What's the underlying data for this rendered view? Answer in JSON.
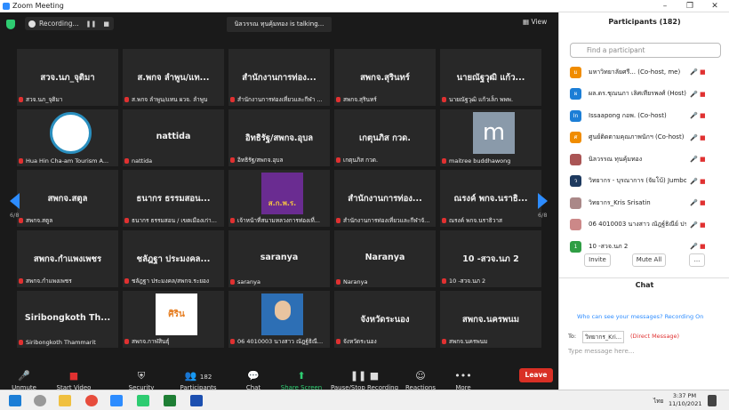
{
  "window": {
    "title": "Zoom Meeting",
    "minimize": "–",
    "maximize": "❐",
    "close": "✕"
  },
  "topbar": {
    "recording": "Recording...",
    "pause": "❚❚",
    "stop": "■",
    "talking": "นิลวรรณ ทุนคุ้มทอง is talking...",
    "view": "View"
  },
  "tiles": [
    {
      "name": "สวจ.นภ_จุติมา",
      "label": "สวจ.นภ_จุติมา"
    },
    {
      "name": "ส.พกจ ลำพูน/แท...",
      "label": "ส.พกจ ลำพูน/แทน ผวจ. ลำพูน"
    },
    {
      "name": "สำนักงานการท่อง...",
      "label": "สำนักงานการท่องเที่ยวและกีฬา ..."
    },
    {
      "name": "สพกจ.สุรินทร์",
      "label": "สพกจ.สุรินทร์"
    },
    {
      "name": "นายณัฐวุฒิ แก้ว...",
      "label": "นายณัฐวุฒิ แก้วเล็ก พพพ."
    },
    {
      "name": "",
      "label": "Hua Hin Cha-am Tourism A..."
    },
    {
      "name": "nattida",
      "label": "nattida"
    },
    {
      "name": "อิทธิรัฐ/สพกจ.อุบล",
      "label": "อิทธิรัฐ/สพกจ.อุบล"
    },
    {
      "name": "เกตุนภิส กวด.",
      "label": "เกตุนภิส กวด."
    },
    {
      "name": "m",
      "label": "maitree buddhawong"
    },
    {
      "name": "สพกจ.สตูล",
      "label": "สพกจ.สตูล"
    },
    {
      "name": "ธนากร ธรรมสอน...",
      "label": "ธนากร ธรรมสอน / เขตเมืองเก่า..."
    },
    {
      "name": "ส.ก.พ.ร.",
      "label": "เจ้าหน้าที่สนามหลวงการท่องเที่..."
    },
    {
      "name": "สำนักงานการท่อง...",
      "label": "สำนักงานการท่องเที่ยวและกีฬาจั..."
    },
    {
      "name": "ณรงค์ พกจ.นราธิ...",
      "label": "ณรงค์ พกจ.นราธิวาส"
    },
    {
      "name": "สพกจ.กำแพงเพชร",
      "label": "สพกจ.กำแพงเพชร"
    },
    {
      "name": "ชลัฎฐา ประมงคล...",
      "label": "ชลัฎฐา ประมงคล/สพกจ.ระยอง"
    },
    {
      "name": "saranya",
      "label": "saranya"
    },
    {
      "name": "Naranya",
      "label": "Naranya"
    },
    {
      "name": "10 -สวจ.นภ 2",
      "label": "10 -สวจ.นภ 2"
    },
    {
      "name": "Siribongkoth  Th...",
      "label": "Siribongkoth Thammarit"
    },
    {
      "name": "ศิริน",
      "label": "สพกจ.กาฬสินธุ์"
    },
    {
      "name": "",
      "label": "06 4010003 นางสาว ณัฎฐ์ธิณี..."
    },
    {
      "name": "จังหวัดระนอง",
      "label": "จังหวัดระนอง"
    },
    {
      "name": "สพกจ.นครพนม",
      "label": "สพกจ.นครพนม"
    }
  ],
  "paging": {
    "left": "6/8",
    "right": "6/8"
  },
  "toolbar": {
    "unmute": "Unmute",
    "video": "Start Video",
    "security": "Security",
    "participants": "Participants",
    "count": "182",
    "chat": "Chat",
    "share": "Share Screen",
    "record": "Pause/Stop Recording",
    "reactions": "Reactions",
    "more": "More",
    "leave": "Leave"
  },
  "panel": {
    "title": "Participants (182)",
    "search_placeholder": "Find a participant",
    "participants": [
      {
        "avatar": "ม",
        "color": "#f08c00",
        "name": "มหาวิทยาลัยศรี... (Co-host, me)"
      },
      {
        "avatar": "ผ",
        "color": "#1c7ed6",
        "name": "ผล.ดร.ชุณนภา เลิศเทียรพงศ์ (Host)"
      },
      {
        "avatar": "In",
        "color": "#1c7ed6",
        "name": "Issaapong กอพ. (Co-host)"
      },
      {
        "avatar": "ศ",
        "color": "#f08c00",
        "name": "ศูนย์ติดตามคุณภาพนักฯ (Co-host)"
      },
      {
        "avatar": "",
        "color": "#a55",
        "name": "นิลวรรณ ทุนคุ้มทอง"
      },
      {
        "avatar": "ว",
        "color": "#1e3a5f",
        "name": "วิทยากร - บุรณาการ (จัมโบ้) Jumbo ..."
      },
      {
        "avatar": "",
        "color": "#a88",
        "name": "วิทยากร_Kris Srisatin"
      },
      {
        "avatar": "",
        "color": "#c88",
        "name": "06 4010003 นางสาว ณัฎฐ์ธิณีย์ ประ..."
      },
      {
        "avatar": "1",
        "color": "#2f9e44",
        "name": "10 -สวจ.นภ 2"
      }
    ],
    "invite": "Invite",
    "mute_all": "Mute All",
    "more": "...",
    "chat_title": "Chat",
    "chat_notice": "Who can see your messages? Recording On",
    "to_label": "To:",
    "to_value": "วิทยากร_Kri...",
    "direct": "(Direct Message)",
    "placeholder": "Type message here..."
  },
  "taskbar": {
    "time": "3:37 PM",
    "date": "11/10/2021",
    "lang": "ไทย"
  },
  "colors": {
    "accent": "#2d8cff",
    "leave": "#d93025",
    "mic_off": "#e03131"
  }
}
